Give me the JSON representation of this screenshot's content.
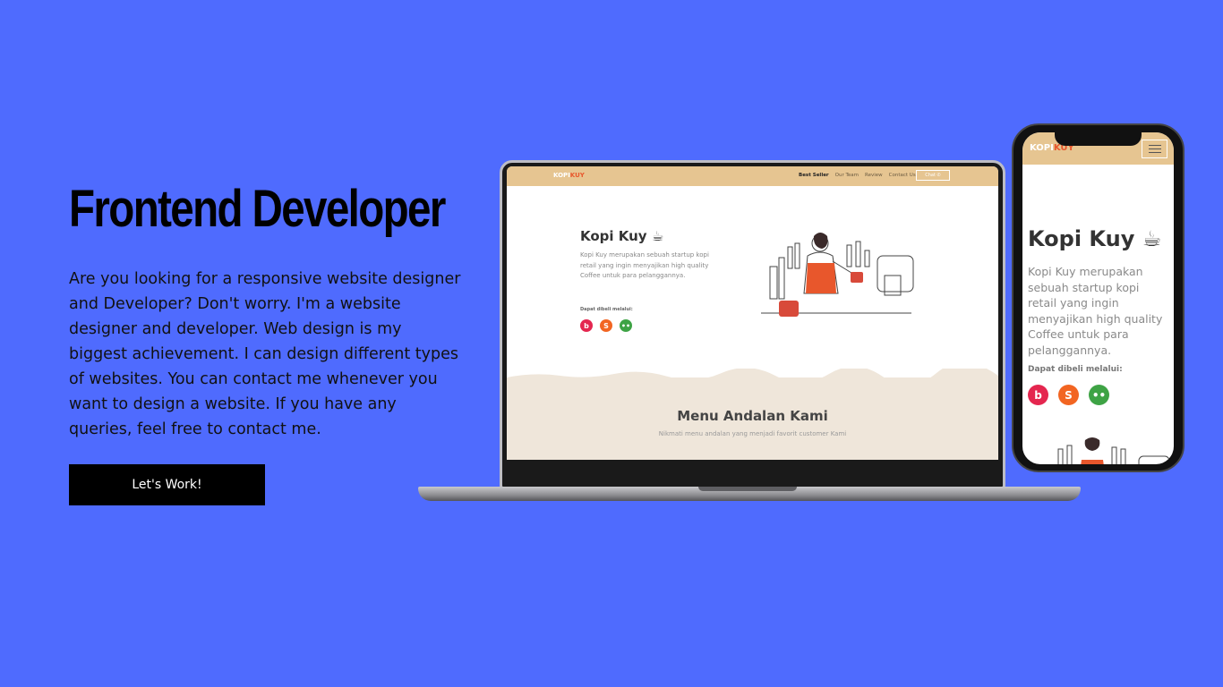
{
  "hero": {
    "title": "Frontend Developer",
    "description": "Are you looking for a responsive website designer and Developer? Don't worry. I'm a website designer and developer. Web design is my biggest achievement. I can design different types of websites. You can contact me whenever you want to design a website. If you have any queries, feel free to contact me.",
    "cta_label": "Let's Work!"
  },
  "mockup_site": {
    "logo_prefix": "KOPI",
    "logo_suffix": "KUY",
    "nav": [
      "Best Seller",
      "Our Team",
      "Review",
      "Contact Us"
    ],
    "chat_label": "Chat",
    "brand": "Kopi Kuy",
    "brand_icon": "coffee-cup-icon",
    "description": "Kopi Kuy merupakan sebuah startup kopi retail yang ingin menyajikan high quality Coffee untuk para pelanggannya.",
    "buy_label": "Dapat dibeli melalui:",
    "shops": [
      {
        "name": "bukalapak-icon",
        "glyph": "b",
        "color": "#e4264f"
      },
      {
        "name": "shopee-icon",
        "glyph": "S",
        "color": "#f26522"
      },
      {
        "name": "tokopedia-icon",
        "glyph": "••",
        "color": "#3ea345"
      }
    ],
    "menu_title": "Menu Andalan Kami",
    "menu_subtitle": "Nikmati menu andalan yang menjadi favorit customer Kami"
  },
  "colors": {
    "background": "#4f6bfe",
    "nav": "#e6c591",
    "accent": "#e8572c",
    "cta": "#000000"
  }
}
